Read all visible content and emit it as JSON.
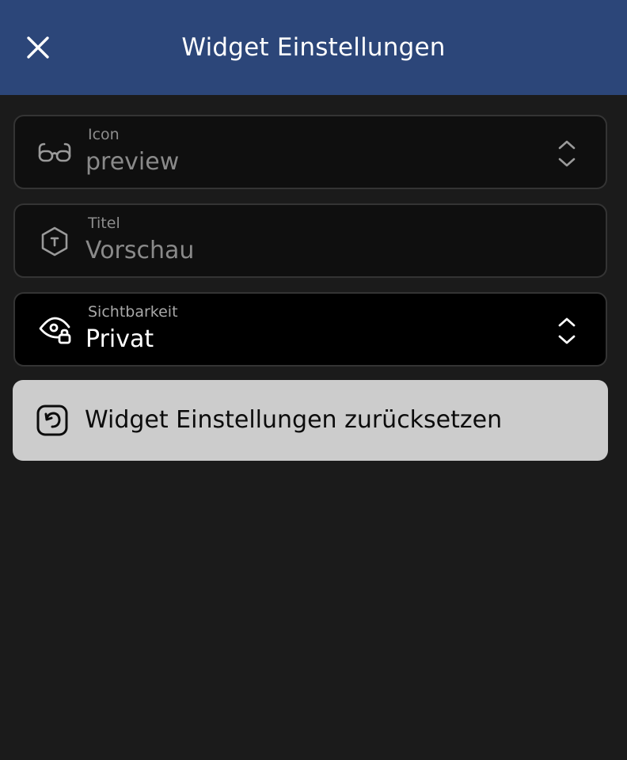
{
  "header": {
    "title": "Widget Einstellungen",
    "close_icon": "close-icon",
    "background_color": "#2c4679"
  },
  "fields": {
    "icon": {
      "label": "Icon",
      "value": "preview",
      "icon": "glasses-icon",
      "has_selector": true
    },
    "title": {
      "label": "Titel",
      "value": "Vorschau",
      "icon": "text-hexagon-icon",
      "has_selector": false
    },
    "visibility": {
      "label": "Sichtbarkeit",
      "value": "Privat",
      "icon": "eye-lock-icon",
      "has_selector": true
    }
  },
  "reset": {
    "label": "Widget Einstellungen zurücksetzen",
    "icon": "reset-icon",
    "background_color": "#cccccc"
  }
}
